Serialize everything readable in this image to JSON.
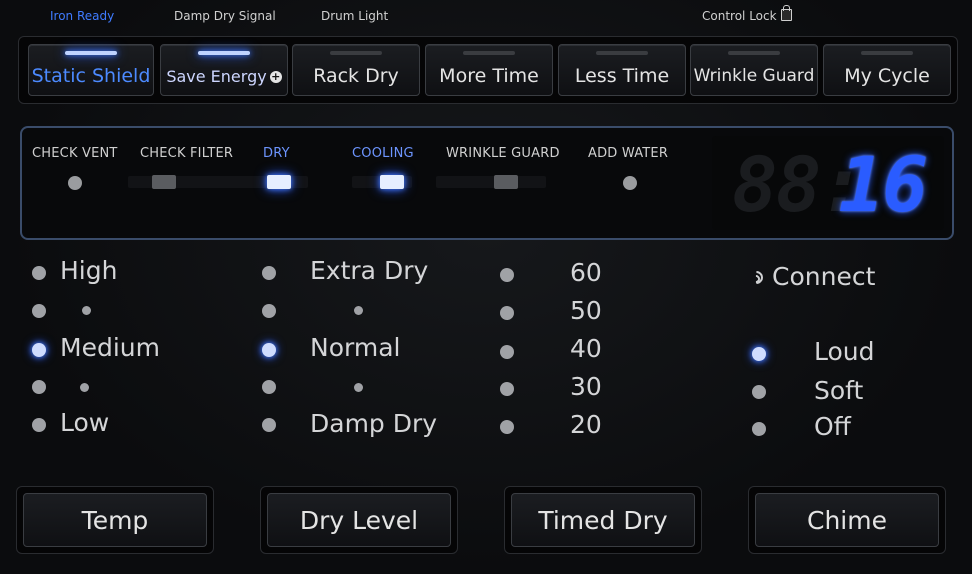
{
  "top_labels": {
    "iron_ready": "Iron Ready",
    "damp_dry_signal": "Damp Dry Signal",
    "drum_light": "Drum Light",
    "control_lock": "Control Lock"
  },
  "cycle_buttons": [
    {
      "label": "Static Shield",
      "active": true
    },
    {
      "label": "Save Energy",
      "active": true
    },
    {
      "label": "Rack Dry",
      "active": false
    },
    {
      "label": "More Time",
      "active": false
    },
    {
      "label": "Less Time",
      "active": false
    },
    {
      "label": "Wrinkle Guard",
      "active": false
    },
    {
      "label": "My Cycle",
      "active": false
    }
  ],
  "status": {
    "check_vent": "CHECK VENT",
    "check_filter": "CHECK FILTER",
    "dry": "DRY",
    "cooling": "COOLING",
    "wrinkle_guard": "WRINKLE GUARD",
    "add_water": "ADD WATER",
    "display_value": "16"
  },
  "temp_options": {
    "high": "High",
    "medium": "Medium",
    "low": "Low",
    "selected": "Medium"
  },
  "dry_level_options": {
    "extra_dry": "Extra Dry",
    "normal": "Normal",
    "damp_dry": "Damp Dry",
    "selected": "Normal"
  },
  "timed_dry_options": [
    "60",
    "50",
    "40",
    "30",
    "20"
  ],
  "chime": {
    "connect": "Connect",
    "loud": "Loud",
    "soft": "Soft",
    "off": "Off",
    "selected": "Loud"
  },
  "bottom_buttons": {
    "temp": "Temp",
    "dry_level": "Dry Level",
    "timed_dry": "Timed Dry",
    "chime": "Chime"
  },
  "colors": {
    "accent": "#2a5cff",
    "panel_bg": "#0b0c0e"
  }
}
